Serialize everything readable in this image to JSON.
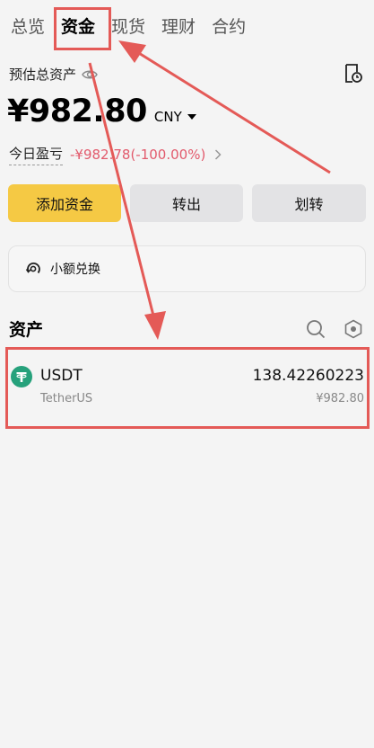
{
  "tabs": [
    {
      "label": "总览",
      "active": false
    },
    {
      "label": "资金",
      "active": true
    },
    {
      "label": "现货",
      "active": false
    },
    {
      "label": "理财",
      "active": false
    },
    {
      "label": "合约",
      "active": false
    }
  ],
  "summary": {
    "estimated_total_label": "预估总资产",
    "balance": "¥982.80",
    "currency": "CNY",
    "pnl_label": "今日盈亏",
    "pnl_value": "-¥982.78(-100.00%)"
  },
  "actions": {
    "deposit": "添加资金",
    "withdraw": "转出",
    "transfer": "划转"
  },
  "small_convert": {
    "label": "小额兑换"
  },
  "assets": {
    "title": "资产",
    "items": [
      {
        "symbol": "USDT",
        "name": "TetherUS",
        "amount": "138.42260223",
        "value": "¥982.80"
      }
    ]
  },
  "colors": {
    "accent_yellow": "#f5c944",
    "loss_red": "#e25a6c",
    "annotation_red": "#e45a57",
    "tether_green": "#26a17b"
  },
  "icons": [
    "eye-icon",
    "history-icon",
    "chevron-right-icon",
    "caret-down-icon",
    "convert-icon",
    "search-icon",
    "settings-icon",
    "tether-icon"
  ]
}
